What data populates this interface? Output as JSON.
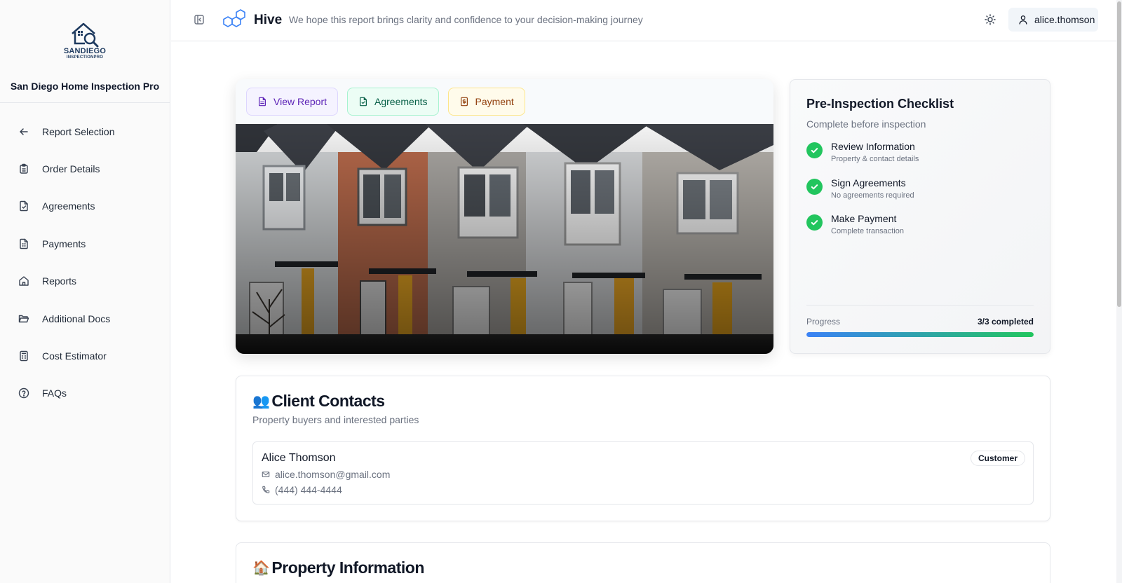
{
  "sidebar": {
    "logo_line1": "SANDIEGO",
    "logo_line2": "INSPECTIONPRO",
    "company": "San Diego Home Inspection Pro",
    "items": [
      {
        "label": "Report Selection",
        "icon": "arrow-left-icon"
      },
      {
        "label": "Order Details",
        "icon": "clipboard-icon"
      },
      {
        "label": "Agreements",
        "icon": "file-check-icon"
      },
      {
        "label": "Payments",
        "icon": "receipt-icon"
      },
      {
        "label": "Reports",
        "icon": "home-icon"
      },
      {
        "label": "Additional Docs",
        "icon": "folder-open-icon"
      },
      {
        "label": "Cost Estimator",
        "icon": "calculator-icon"
      },
      {
        "label": "FAQs",
        "icon": "help-circle-icon"
      }
    ]
  },
  "header": {
    "app_name": "Hive",
    "tagline": "We hope this report brings clarity and confidence to your decision-making journey",
    "username": "alice.thomson"
  },
  "hero": {
    "tabs": [
      {
        "label": "View Report",
        "icon": "file-text-icon"
      },
      {
        "label": "Agreements",
        "icon": "file-check-icon"
      },
      {
        "label": "Payment",
        "icon": "dollar-file-icon"
      }
    ]
  },
  "checklist": {
    "title": "Pre-Inspection Checklist",
    "subtitle": "Complete before inspection",
    "items": [
      {
        "title": "Review Information",
        "subtitle": "Property & contact details"
      },
      {
        "title": "Sign Agreements",
        "subtitle": "No agreements required"
      },
      {
        "title": "Make Payment",
        "subtitle": "Complete transaction"
      }
    ],
    "progress_label": "Progress",
    "progress_text": "3/3 completed",
    "progress_fraction": 1.0
  },
  "contacts": {
    "emoji": "👥",
    "title": "Client Contacts",
    "subtitle": "Property buyers and interested parties",
    "contact": {
      "name": "Alice Thomson",
      "email": "alice.thomson@gmail.com",
      "phone": "(444) 444-4444",
      "role": "Customer"
    }
  },
  "property": {
    "emoji": "🏠",
    "title": "Property Information"
  },
  "colors": {
    "accent_green": "#22c55e",
    "accent_blue": "#3b82f6",
    "brand_navy": "#1e3a5f"
  }
}
